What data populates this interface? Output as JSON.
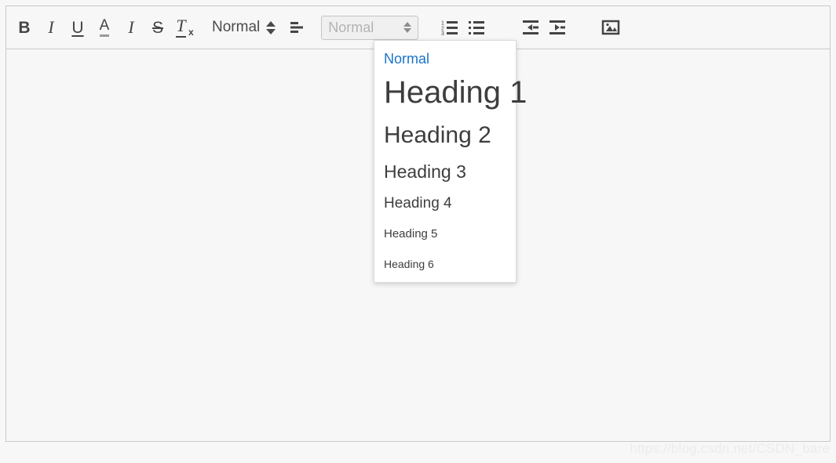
{
  "toolbar": {
    "buttons": [
      {
        "name": "bold-icon",
        "label": "B",
        "title": "Bold"
      },
      {
        "name": "italic-icon",
        "label": "I",
        "title": "Italic"
      },
      {
        "name": "underline-icon",
        "label": "U",
        "title": "Underline"
      },
      {
        "name": "text-color-icon",
        "label": "A",
        "title": "Text color"
      },
      {
        "name": "italic-serif-icon",
        "label": "I",
        "title": "Italic"
      },
      {
        "name": "strikethrough-icon",
        "label": "S",
        "title": "Strikethrough"
      },
      {
        "name": "remove-format-icon",
        "label": "T",
        "sub": "x",
        "title": "Remove formatting"
      }
    ],
    "size_select": {
      "value": "Normal",
      "icon": "stepper-arrows-icon"
    },
    "align_button": {
      "name": "align-left-icon",
      "title": "Align"
    },
    "format_select": {
      "value": "Normal",
      "icon": "stepper-arrows-icon",
      "state": "open"
    },
    "list_buttons": [
      {
        "name": "ordered-list-icon",
        "title": "Numbered list"
      },
      {
        "name": "unordered-list-icon",
        "title": "Bulleted list"
      }
    ],
    "indent_buttons": [
      {
        "name": "outdent-icon",
        "title": "Decrease indent"
      },
      {
        "name": "indent-icon",
        "title": "Increase indent"
      }
    ],
    "image_button": {
      "name": "image-icon",
      "title": "Insert image"
    }
  },
  "dropdown": {
    "items": [
      {
        "label": "Normal",
        "selected": true
      },
      {
        "label": "Heading 1",
        "selected": false
      },
      {
        "label": "Heading 2",
        "selected": false
      },
      {
        "label": "Heading 3",
        "selected": false
      },
      {
        "label": "Heading 4",
        "selected": false
      },
      {
        "label": "Heading 5",
        "selected": false
      },
      {
        "label": "Heading 6",
        "selected": false
      }
    ]
  },
  "editor": {
    "content": ""
  },
  "watermark": {
    "text": "https://blog.csdn.net/CSDN_bare"
  },
  "colors": {
    "page_background": "#f7f7f7",
    "border": "#c9c9c9",
    "icon": "#444444",
    "selected_item": "#1a73c8",
    "dropdown_background": "#ffffff",
    "select_box_background": "#f0f0f0",
    "select_box_text": "#b3b3b3",
    "watermark": "#ececec"
  }
}
